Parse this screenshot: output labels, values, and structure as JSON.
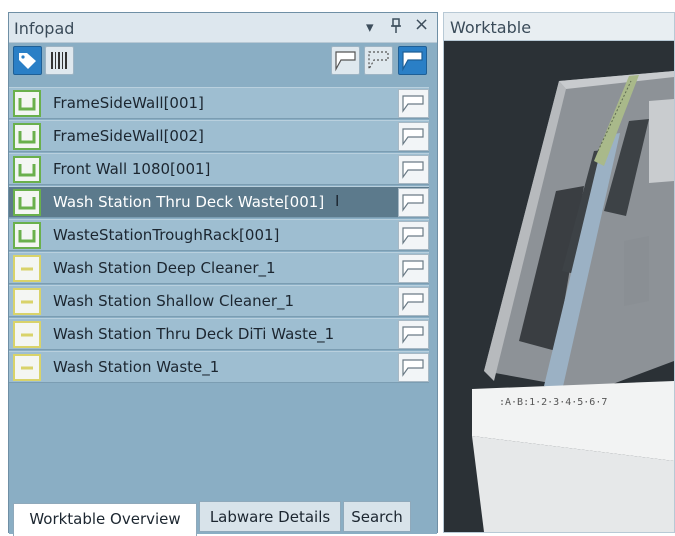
{
  "infopad": {
    "title": "Infopad",
    "header_buttons": {
      "dropdown": "▾",
      "pin": "ꟼ",
      "close": "×"
    },
    "items": [
      {
        "label": "FrameSideWall[001]",
        "icon": "carrier-green-icon",
        "selected": false
      },
      {
        "label": "FrameSideWall[002]",
        "icon": "carrier-green-icon",
        "selected": false
      },
      {
        "label": "Front Wall 1080[001]",
        "icon": "carrier-green-icon",
        "selected": false
      },
      {
        "label": "Wash Station Thru Deck Waste[001]",
        "icon": "carrier-green-icon",
        "selected": true
      },
      {
        "label": "WasteStationTroughRack[001]",
        "icon": "carrier-green-icon",
        "selected": false
      },
      {
        "label": "Wash Station Deep Cleaner_1",
        "icon": "labware-yellow-icon",
        "selected": false
      },
      {
        "label": "Wash Station Shallow Cleaner_1",
        "icon": "labware-yellow-icon",
        "selected": false
      },
      {
        "label": "Wash Station Thru Deck DiTi Waste_1",
        "icon": "labware-yellow-icon",
        "selected": false
      },
      {
        "label": "Wash Station Waste_1",
        "icon": "labware-yellow-icon",
        "selected": false
      }
    ],
    "tabs": [
      {
        "label": "Worktable Overview",
        "active": true
      },
      {
        "label": "Labware Details",
        "active": false
      },
      {
        "label": "Search",
        "active": false
      }
    ]
  },
  "worktable": {
    "title": "Worktable",
    "grid_label": ":A·B:1·2·3·4·5·6·7"
  },
  "colors": {
    "panel_bg": "#8aaec4",
    "row_bg": "#9ebed1",
    "row_selected": "#5c7a8c",
    "accent_blue": "#2a7fc6",
    "carrier_green": "#6ab04c",
    "labware_yellow": "#d9d36a",
    "viewport_bg": "#2b3136"
  }
}
